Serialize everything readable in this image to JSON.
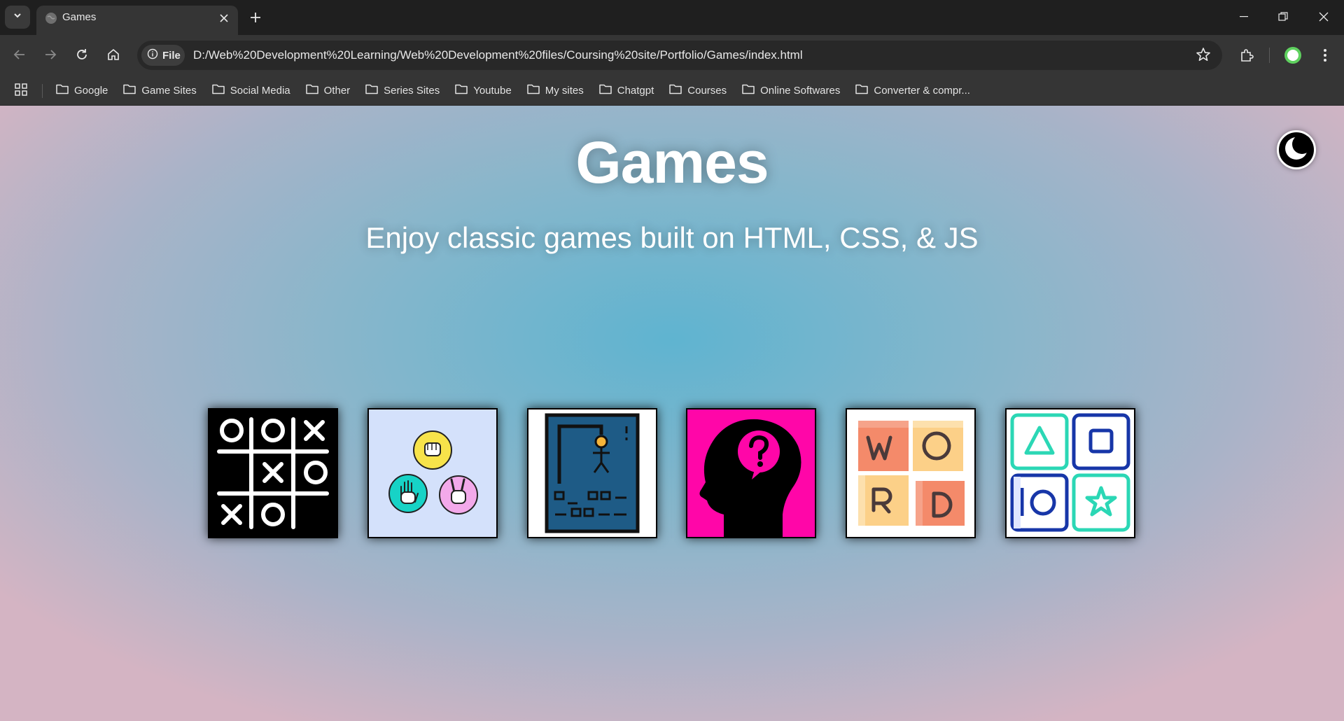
{
  "browser": {
    "tab_title": "Games",
    "site_chip_label": "File",
    "url": "D:/Web%20Development%20Learning/Web%20Development%20files/Coursing%20site/Portfolio/Games/index.html",
    "bookmarks": [
      {
        "label": "Google"
      },
      {
        "label": "Game Sites"
      },
      {
        "label": "Social Media"
      },
      {
        "label": "Other"
      },
      {
        "label": "Series Sites"
      },
      {
        "label": "Youtube"
      },
      {
        "label": "My sites"
      },
      {
        "label": "Chatgpt"
      },
      {
        "label": "Courses"
      },
      {
        "label": "Online Softwares"
      },
      {
        "label": "Converter & compr..."
      }
    ]
  },
  "page": {
    "title": "Games",
    "subtitle": "Enjoy classic games built on HTML, CSS, & JS",
    "theme_toggle_icon": "moon-icon",
    "games": [
      {
        "icon": "tic-tac-toe-icon",
        "background": "#000000"
      },
      {
        "icon": "rock-paper-scissors-icon",
        "background": "#d4e1fb"
      },
      {
        "icon": "hangman-icon",
        "background": "#ffffff"
      },
      {
        "icon": "quiz-icon",
        "background": "#ff06a8"
      },
      {
        "icon": "word-game-icon",
        "background": "#ffffff"
      },
      {
        "icon": "memory-shapes-icon",
        "background": "#ffffff"
      }
    ]
  },
  "colors": {
    "browser_bg": "#1f1f1f",
    "toolbar_bg": "#353535",
    "page_center": "#5fb4d0",
    "page_edge": "#d4b4c3"
  }
}
